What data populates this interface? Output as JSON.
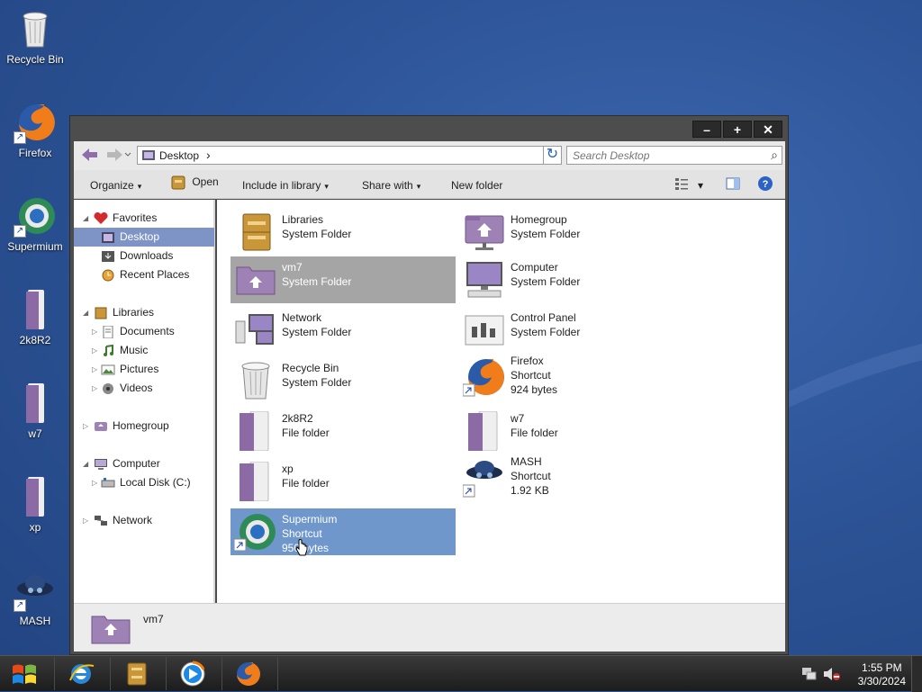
{
  "colors": {
    "accent": "#7e93c6",
    "selected_tile_gray": "#a5a5a5",
    "selected_tile_blue": "#6f97cc",
    "window_frame": "#4d4d4d",
    "desktop_bg": "#2d5497",
    "folder_purple": "#9f82b5"
  },
  "desktop": {
    "icons": [
      {
        "label": "Recycle Bin",
        "icon": "recycle-bin-icon"
      },
      {
        "label": "Firefox",
        "icon": "firefox-icon"
      },
      {
        "label": "Supermium",
        "icon": "supermium-icon"
      },
      {
        "label": "2k8R2",
        "icon": "folder-icon"
      },
      {
        "label": "w7",
        "icon": "folder-icon"
      },
      {
        "label": "xp",
        "icon": "folder-icon"
      },
      {
        "label": "MASH",
        "icon": "mash-icon"
      }
    ]
  },
  "window": {
    "buttons": {
      "minimize": "–",
      "maximize": "+",
      "close": "✕"
    },
    "address": {
      "crumb": "Desktop",
      "separator": "›"
    },
    "search": {
      "placeholder": "Search Desktop"
    },
    "toolbar": {
      "organize": "Organize",
      "open": "Open",
      "include_in_library": "Include in library",
      "share_with": "Share with",
      "new_folder": "New folder"
    },
    "nav": {
      "favorites": "Favorites",
      "desktop": "Desktop",
      "downloads": "Downloads",
      "recent_places": "Recent Places",
      "libraries": "Libraries",
      "documents": "Documents",
      "music": "Music",
      "pictures": "Pictures",
      "videos": "Videos",
      "homegroup": "Homegroup",
      "computer": "Computer",
      "local_disk": "Local Disk (C:)",
      "network": "Network"
    },
    "items": [
      {
        "name": "Libraries",
        "type": "System Folder",
        "size": ""
      },
      {
        "name": "Homegroup",
        "type": "System Folder",
        "size": ""
      },
      {
        "name": "vm7",
        "type": "System Folder",
        "size": ""
      },
      {
        "name": "Computer",
        "type": "System Folder",
        "size": ""
      },
      {
        "name": "Network",
        "type": "System Folder",
        "size": ""
      },
      {
        "name": "Control Panel",
        "type": "System Folder",
        "size": ""
      },
      {
        "name": "Recycle Bin",
        "type": "System Folder",
        "size": ""
      },
      {
        "name": "Firefox",
        "type": "Shortcut",
        "size": "924 bytes"
      },
      {
        "name": "2k8R2",
        "type": "File folder",
        "size": ""
      },
      {
        "name": "w7",
        "type": "File folder",
        "size": ""
      },
      {
        "name": "xp",
        "type": "File folder",
        "size": ""
      },
      {
        "name": "MASH",
        "type": "Shortcut",
        "size": "1.92 KB"
      },
      {
        "name": "Supermium",
        "type": "Shortcut",
        "size": "950 bytes"
      }
    ],
    "details": {
      "name": "vm7"
    }
  },
  "taskbar": {
    "clock_time": "1:55 PM",
    "clock_date": "3/30/2024",
    "pinned": [
      "start-orb-icon",
      "internet-explorer-icon",
      "file-explorer-icon",
      "media-player-icon",
      "firefox-icon"
    ]
  }
}
